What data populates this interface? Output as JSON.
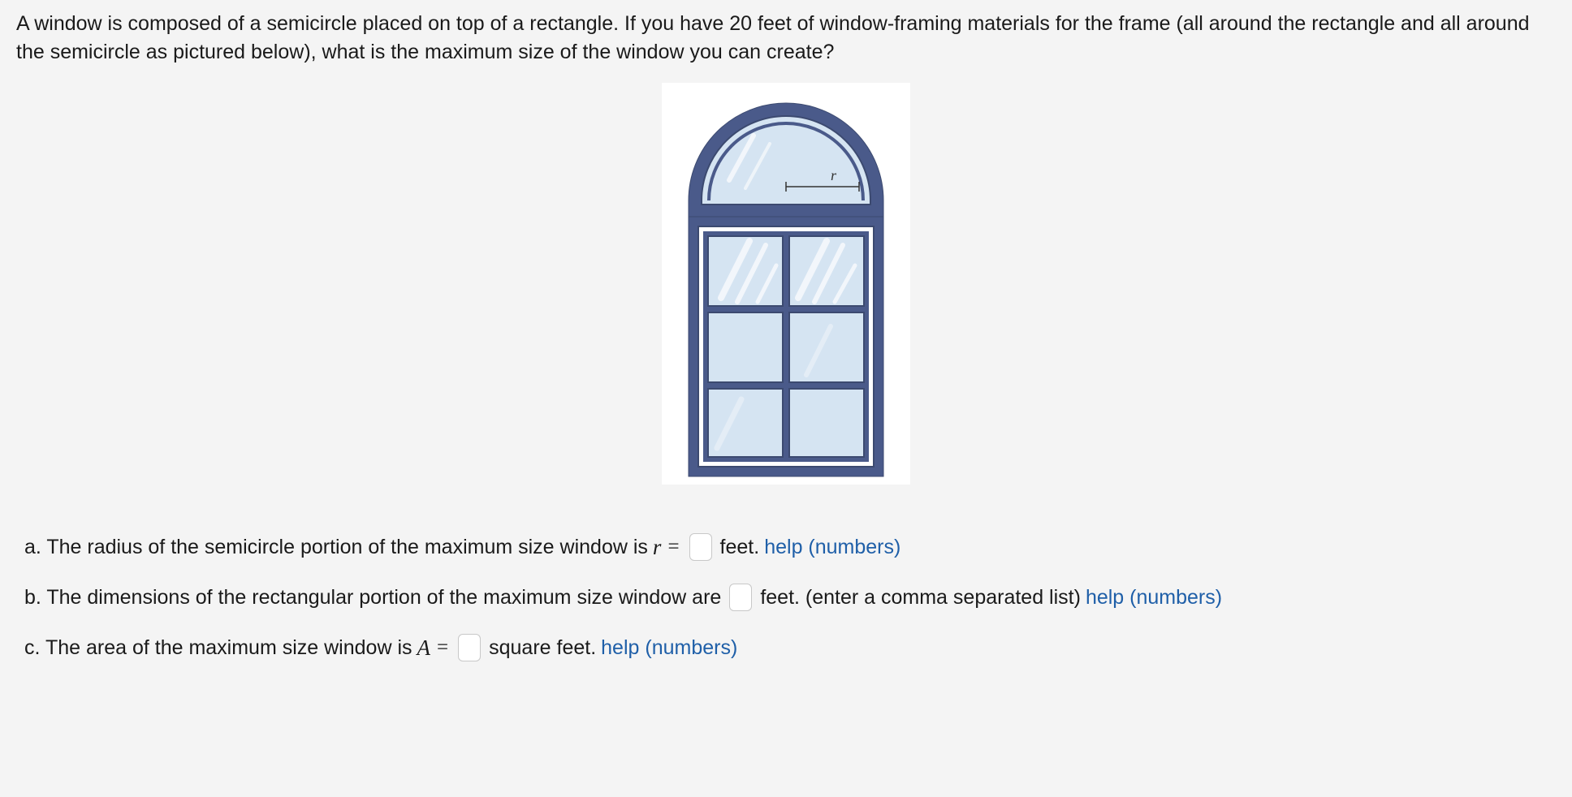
{
  "problem": {
    "text": "A window is composed of a semicircle placed on top of a rectangle. If you have 20 feet of window-framing materials for the frame (all around the rectangle and all around the semicircle as pictured below), what is the maximum size of the window you can create?"
  },
  "image": {
    "radius_label": "r"
  },
  "parts": {
    "a": {
      "prefix": "a. The radius of the semicircle portion of the maximum size window is ",
      "var": "r",
      "eq": "=",
      "unit": "feet.",
      "help": "help (numbers)"
    },
    "b": {
      "prefix": "b. The dimensions of the rectangular portion of the maximum size window are",
      "unit": "feet. (enter a comma separated list)",
      "help": "help (numbers)"
    },
    "c": {
      "prefix": "c. The area of the maximum size window is ",
      "var": "A",
      "eq": "=",
      "unit": "square feet.",
      "help": "help (numbers)"
    }
  }
}
